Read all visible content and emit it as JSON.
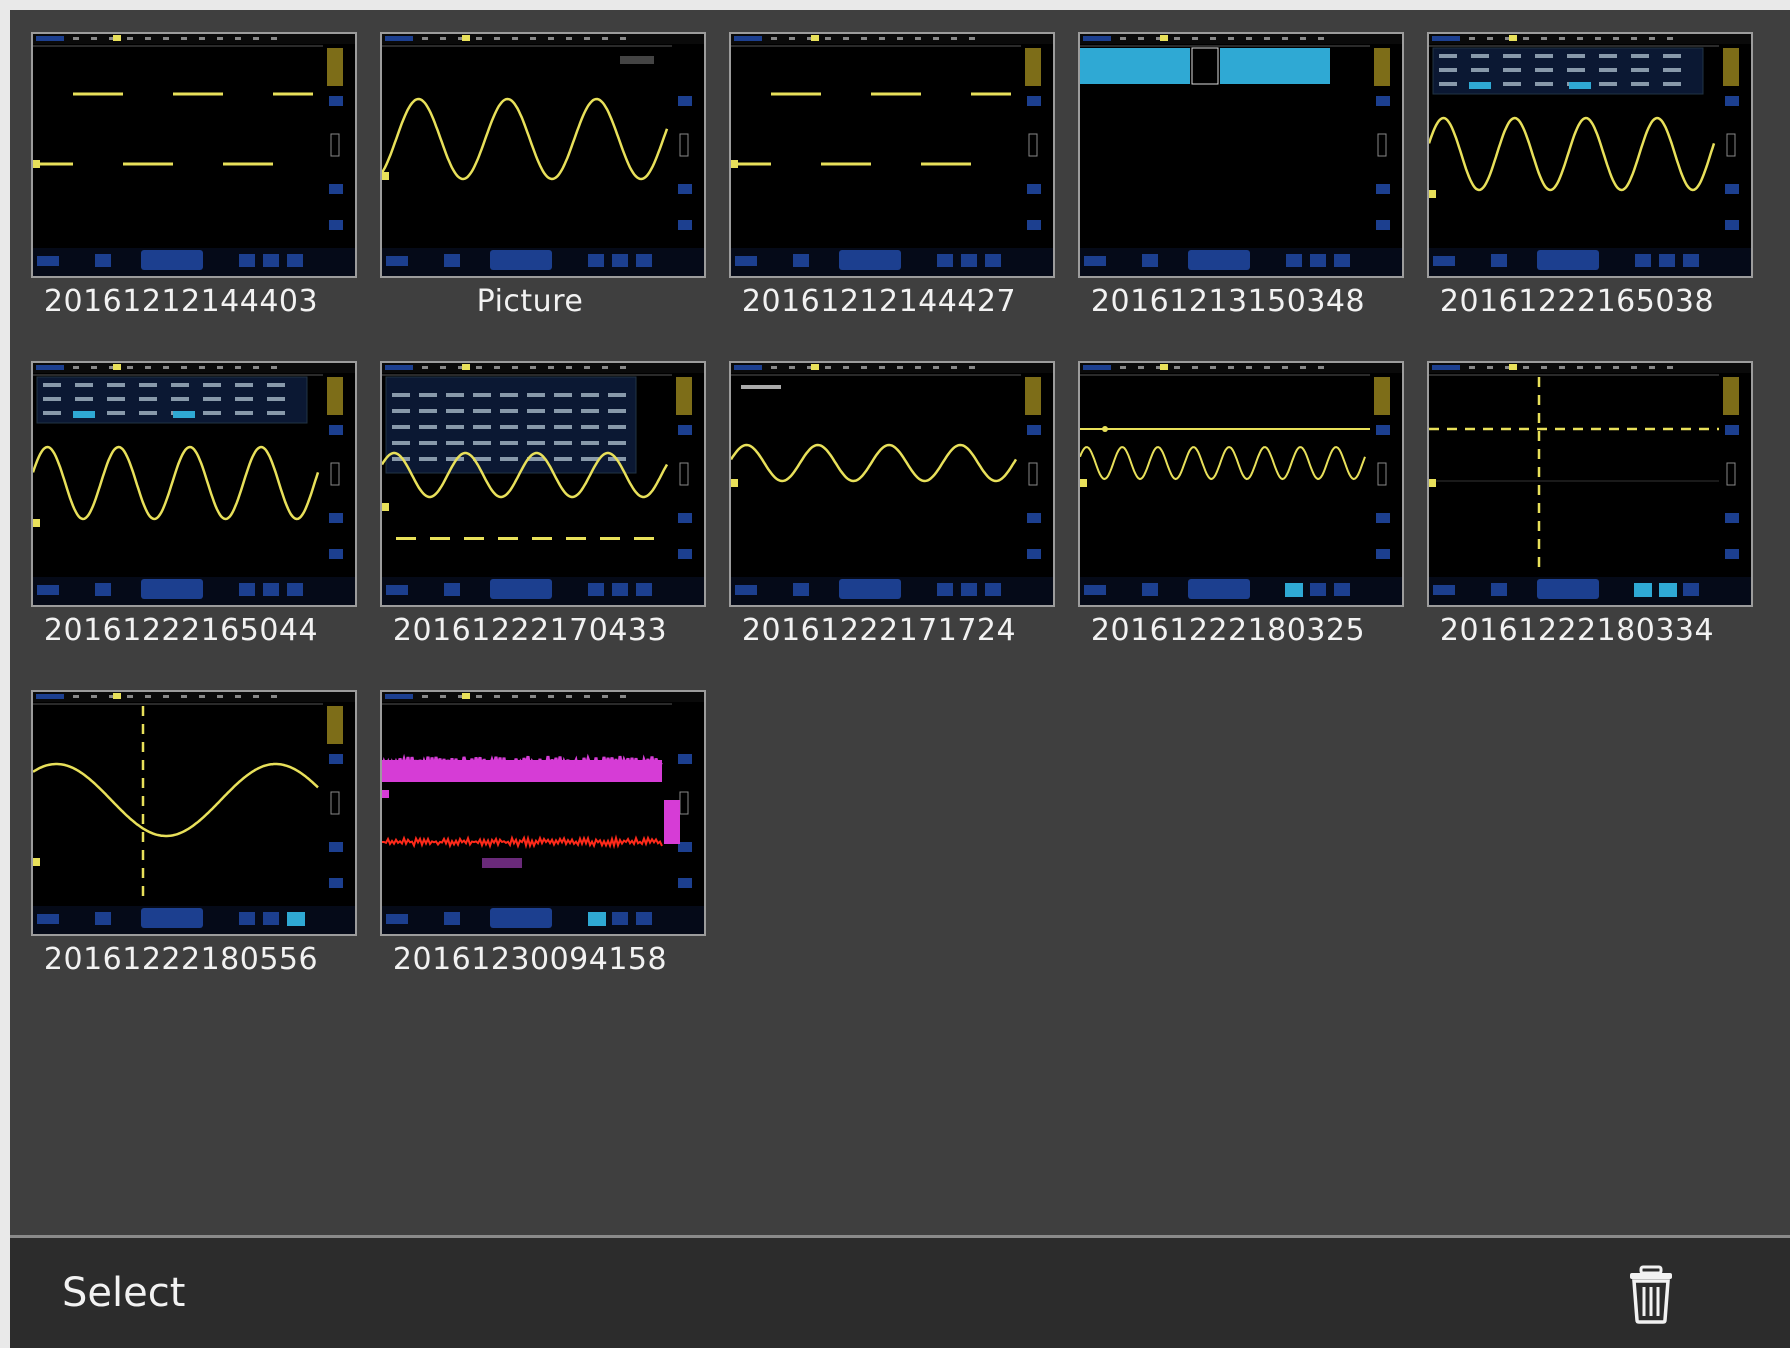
{
  "gallery": {
    "items": [
      {
        "label": "20161212144403",
        "thumb": "square-wave"
      },
      {
        "label": "Picture",
        "thumb": "sine-large"
      },
      {
        "label": "20161212144427",
        "thumb": "square-wave"
      },
      {
        "label": "20161213150348",
        "thumb": "cyan-bar"
      },
      {
        "label": "20161222165038",
        "thumb": "sine-menu"
      },
      {
        "label": "20161222165044",
        "thumb": "sine-menu2"
      },
      {
        "label": "20161222170433",
        "thumb": "sine-table"
      },
      {
        "label": "20161222171724",
        "thumb": "sine-small"
      },
      {
        "label": "20161222180325",
        "thumb": "sine-dense"
      },
      {
        "label": "20161222180334",
        "thumb": "cursors"
      },
      {
        "label": "20161222180556",
        "thumb": "sine-cursor"
      },
      {
        "label": "20161230094158",
        "thumb": "noise"
      }
    ]
  },
  "toolbar": {
    "select_label": "Select",
    "trash_icon": "trash-icon"
  },
  "colors": {
    "background": "#3f3f3f",
    "trace_yellow": "#e8e05a",
    "trace_magenta": "#d63cd6",
    "trace_red": "#ff2a1a",
    "ui_blue": "#1c3f8f",
    "ui_cyan": "#2fa9d4"
  }
}
